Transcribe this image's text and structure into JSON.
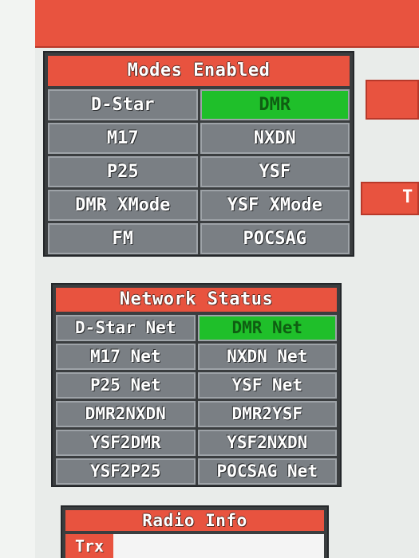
{
  "modes": {
    "title": "Modes Enabled",
    "items": [
      {
        "label": "D-Star",
        "active": false
      },
      {
        "label": "DMR",
        "active": true
      },
      {
        "label": "M17",
        "active": false
      },
      {
        "label": "NXDN",
        "active": false
      },
      {
        "label": "P25",
        "active": false
      },
      {
        "label": "YSF",
        "active": false
      },
      {
        "label": "DMR XMode",
        "active": false
      },
      {
        "label": "YSF XMode",
        "active": false
      },
      {
        "label": "FM",
        "active": false
      },
      {
        "label": "POCSAG",
        "active": false
      }
    ]
  },
  "network": {
    "title": "Network Status",
    "items": [
      {
        "label": "D-Star Net",
        "active": false
      },
      {
        "label": "DMR Net",
        "active": true
      },
      {
        "label": "M17 Net",
        "active": false
      },
      {
        "label": "NXDN Net",
        "active": false
      },
      {
        "label": "P25 Net",
        "active": false
      },
      {
        "label": "YSF Net",
        "active": false
      },
      {
        "label": "DMR2NXDN",
        "active": false
      },
      {
        "label": "DMR2YSF",
        "active": false
      },
      {
        "label": "YSF2DMR",
        "active": false
      },
      {
        "label": "YSF2NXDN",
        "active": false
      },
      {
        "label": "YSF2P25",
        "active": false
      },
      {
        "label": "POCSAG Net",
        "active": false
      }
    ]
  },
  "radio_info": {
    "title": "Radio Info",
    "trx_label": "Trx",
    "trx_value": ""
  },
  "side": {
    "partial_label": "T"
  },
  "colors": {
    "accent": "#e8533f",
    "active": "#1fbf2a",
    "inactive": "#7a7f84",
    "panel": "#3a3d3f"
  }
}
